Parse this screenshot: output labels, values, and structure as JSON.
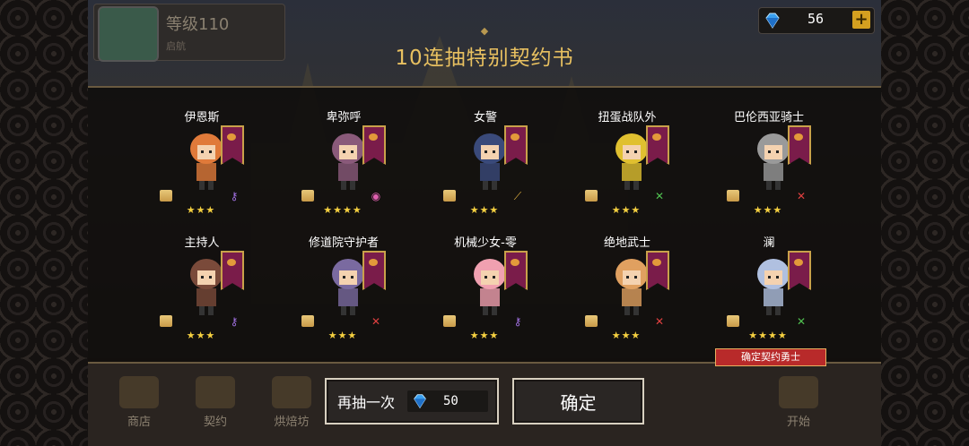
{
  "hud": {
    "level": "等级110",
    "player_name": "启航",
    "gems": "56",
    "plus": "+"
  },
  "title": "10连抽特别契约书",
  "cards": [
    {
      "name": "伊恩斯",
      "stars": "★★★",
      "color": "#e07a3a",
      "weapon": "purple"
    },
    {
      "name": "卑弥呼",
      "stars": "★★★★",
      "color": "#8a5a7a",
      "weapon": "pink"
    },
    {
      "name": "女警",
      "stars": "★★★",
      "color": "#3a4a7a",
      "weapon": "gold"
    },
    {
      "name": "扭蛋战队外",
      "stars": "★★★",
      "color": "#e0c030",
      "weapon": "green"
    },
    {
      "name": "巴伦西亚骑士",
      "stars": "★★★",
      "color": "#9a9a9a",
      "weapon": "red"
    },
    {
      "name": "主持人",
      "stars": "★★★",
      "color": "#7a4a3a",
      "weapon": "purple"
    },
    {
      "name": "修道院守护者",
      "stars": "★★★",
      "color": "#7a6aa0",
      "weapon": "red"
    },
    {
      "name": "机械少女-零",
      "stars": "★★★",
      "color": "#f0a0b0",
      "weapon": "purple"
    },
    {
      "name": "绝地武士",
      "stars": "★★★",
      "color": "#e0a060",
      "weapon": "red"
    },
    {
      "name": "澜",
      "stars": "★★★★",
      "color": "#b0c0e0",
      "weapon": "green"
    }
  ],
  "confirm_tag": "确定契约勇士",
  "buttons": {
    "redraw_label": "再抽一次",
    "redraw_cost": "50",
    "ok_label": "确定"
  },
  "nav": [
    "商店",
    "契约",
    "烘焙坊",
    "",
    "",
    "",
    "",
    "",
    "",
    "开始"
  ]
}
